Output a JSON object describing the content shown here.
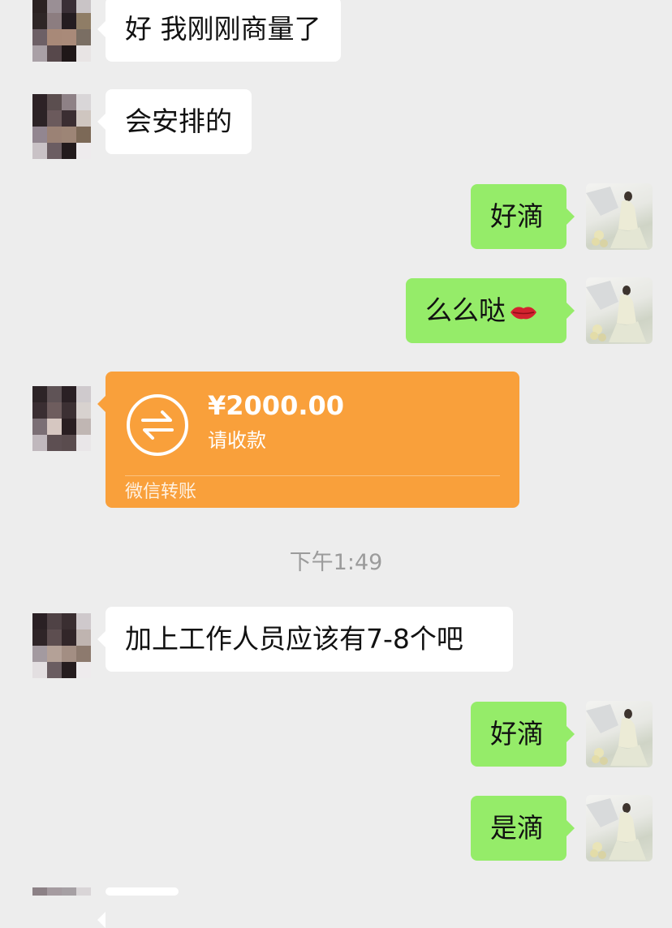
{
  "messages": [
    {
      "side": "in",
      "text": "好 我刚刚商量了"
    },
    {
      "side": "in",
      "text": "会安排的"
    },
    {
      "side": "out",
      "text": "好滴"
    },
    {
      "side": "out",
      "text": "么么哒"
    },
    {
      "side": "in",
      "type": "transfer"
    },
    {
      "side": "in",
      "text": "加上工作人员应该有7-8个吧"
    },
    {
      "side": "out",
      "text": "好滴"
    },
    {
      "side": "out",
      "text": "是滴"
    }
  ],
  "transfer": {
    "amount": "¥2000.00",
    "status": "请收款",
    "footer": "微信转账"
  },
  "timestamp": "下午1:49",
  "colors": {
    "background": "#ededed",
    "incoming_bubble": "#ffffff",
    "outgoing_bubble": "#95ec69",
    "transfer_card": "#f9a03b",
    "timestamp_text": "#9b9b9b"
  },
  "icons": [
    "transfer-arrows-icon",
    "lips-emoji-icon"
  ]
}
